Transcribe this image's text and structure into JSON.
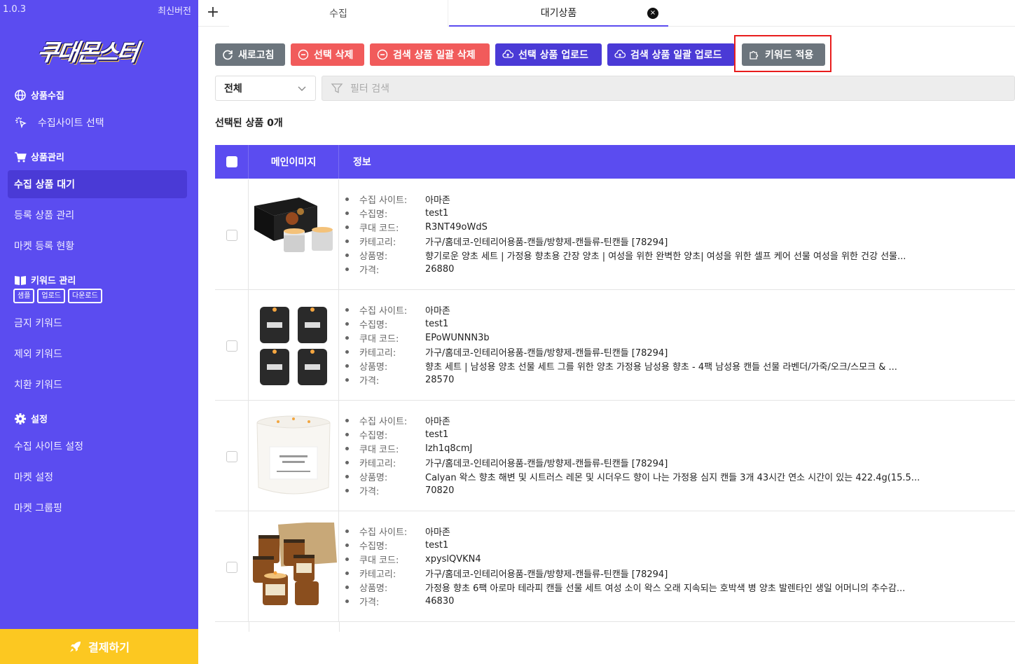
{
  "sidebar": {
    "version": "1.0.3",
    "latest": "최신버전",
    "logo": "쿠대몬스터",
    "sections": {
      "collect": "상품수집",
      "manage": "상품관리",
      "keyword": "키워드 관리",
      "settings": "설정"
    },
    "items": {
      "site_select": "수집사이트 선택",
      "waiting": "수집 상품 대기",
      "registered": "등록 상품 관리",
      "market_status": "마켓 등록 현황",
      "banned": "금지 키워드",
      "excluded": "제외 키워드",
      "replace": "치환 키워드",
      "site_settings": "수집 사이트 설정",
      "market_settings": "마켓 설정",
      "market_group": "마켓 그룹핑"
    },
    "keyword_badges": [
      "샘플",
      "업로드",
      "다운로드"
    ],
    "pay_button": "결제하기"
  },
  "tabs": {
    "add": "+",
    "items": [
      "수집",
      "대기상품"
    ],
    "close": "×"
  },
  "toolbar": {
    "refresh": "새로고침",
    "delete_selected": "선택 삭제",
    "delete_search_all": "검색 상품 일괄 삭제",
    "upload_selected": "선택 상품 업로드",
    "upload_search_all": "검색 상품 일괄 업로드",
    "apply_keyword": "키워드 적용"
  },
  "filter": {
    "select_value": "전체",
    "placeholder": "필터 검색"
  },
  "selected_count": "선택된 상품  0개",
  "table": {
    "headers": [
      "메인이미지",
      "정보"
    ],
    "labels": [
      "수집 사이트:",
      "수집명:",
      "쿠대 코드:",
      "카테고리:",
      "상품명:",
      "가격:"
    ],
    "rows": [
      {
        "site": "아마존",
        "collect_name": "test1",
        "code": "R3NT49oWdS",
        "category": "가구/홈데코-인테리어용품-캔들/방향제-캔들류-틴캔들 [78294]",
        "name": "향기로운 양초 세트 | 가정용 향초용 간장 양초 | 여성을 위한 완벽한 양초| 여성을 위한 셀프 케어 선물 여성을 위한 건강 선물...",
        "price": "26880"
      },
      {
        "site": "아마존",
        "collect_name": "test1",
        "code": "EPoWUNNN3b",
        "category": "가구/홈데코-인테리어용품-캔들/방향제-캔들류-틴캔들 [78294]",
        "name": "향초 세트 | 남성용 양초 선물 세트 그를 위한 양초 가정용 남성용 향초 - 4팩 남성용 캔들 선물 라벤더/가죽/오크/스모크 & ...",
        "price": "28570"
      },
      {
        "site": "아마존",
        "collect_name": "test1",
        "code": "Izh1q8cmJ",
        "category": "가구/홈데코-인테리어용품-캔들/방향제-캔들류-틴캔들 [78294]",
        "name": "Calyan 왁스 향초 해변 및 시트러스 레몬 및 시더우드 향이 나는 가정용 심지 캔들 3개 43시간 연소 시간이 있는 422.4g(15.5...",
        "price": "70820"
      },
      {
        "site": "아마존",
        "collect_name": "test1",
        "code": "xpyslQVKN4",
        "category": "가구/홈데코-인테리어용품-캔들/방향제-캔들류-틴캔들 [78294]",
        "name": "가정용 향초 6팩 아로마 테라피 캔들 선물 세트 여성 소이 왁스 오래 지속되는 호박색 병 양초 발렌타인 생일 어머니의 추수감...",
        "price": "46830"
      }
    ]
  },
  "colors": {
    "primary": "#5b4cf0",
    "active": "#4a3ad6",
    "danger": "#f15b5b",
    "neutral": "#6c757d",
    "pay": "#fcc821",
    "highlight": "#e81d1d"
  }
}
